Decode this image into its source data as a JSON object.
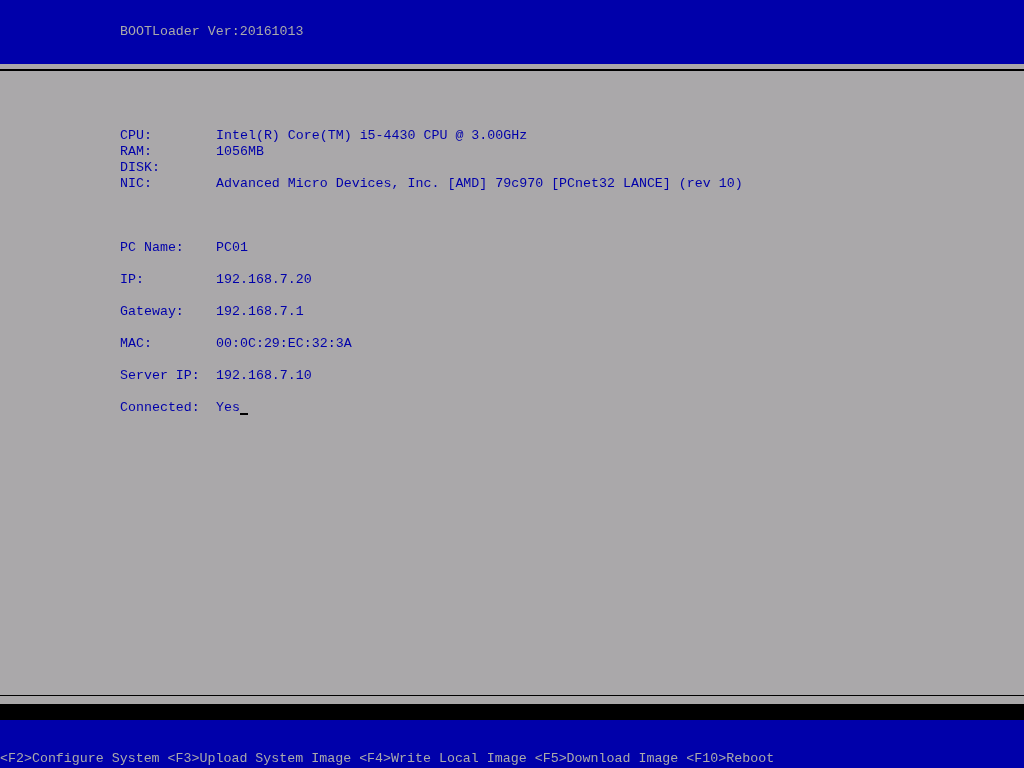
{
  "header": {
    "title": "BOOTLoader Ver:20161013"
  },
  "hardware": [
    {
      "label": "CPU:",
      "value": "Intel(R) Core(TM) i5-4430 CPU @ 3.00GHz"
    },
    {
      "label": "RAM:",
      "value": "1056MB"
    },
    {
      "label": "DISK:"
    },
    {
      "label": "NIC:",
      "value": "Advanced Micro Devices, Inc. [AMD] 79c970 [PCnet32 LANCE] (rev 10)"
    }
  ],
  "network": [
    {
      "label": "PC Name:",
      "value": "PC01"
    },
    {
      "label": "IP:",
      "value": "192.168.7.20"
    },
    {
      "label": "Gateway:",
      "value": "192.168.7.1"
    },
    {
      "label": "MAC:",
      "value": "00:0C:29:EC:32:3A"
    },
    {
      "label": "Server IP:",
      "value": "192.168.7.10"
    },
    {
      "label": "Connected:",
      "value": "Yes"
    }
  ],
  "footer": {
    "items": [
      "<F2>Configure System",
      "<F3>Upload System Image",
      "<F4>Write Local Image",
      "<F5>Download Image",
      "<F10>Reboot"
    ]
  }
}
